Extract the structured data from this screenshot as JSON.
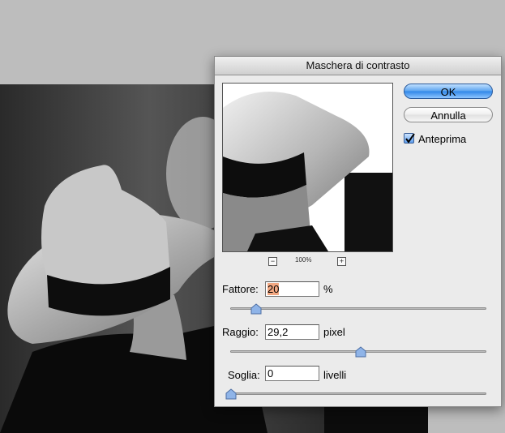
{
  "dialog": {
    "title": "Maschera di contrasto",
    "ok_label": "OK",
    "cancel_label": "Annulla",
    "preview_label": "Anteprima",
    "preview_checked": true,
    "zoom_level": "100%",
    "zoom_minus": "−",
    "zoom_plus": "+"
  },
  "amount": {
    "label": "Fattore:",
    "value": "20",
    "unit": "%",
    "slider_fraction": 0.1
  },
  "radius": {
    "label": "Raggio:",
    "value": "29,2",
    "unit": "pixel",
    "slider_fraction": 0.51
  },
  "threshold": {
    "label": "Soglia:",
    "value": "0",
    "unit": "livelli",
    "slider_fraction": 0.0
  },
  "colors": {
    "accent": "#3a8be8",
    "slider_thumb": "#8fb4e8",
    "dialog_bg": "#ebebeb"
  },
  "icons": {
    "checkbox": "checkmark-icon",
    "slider_thumb": "slider-thumb-icon"
  }
}
